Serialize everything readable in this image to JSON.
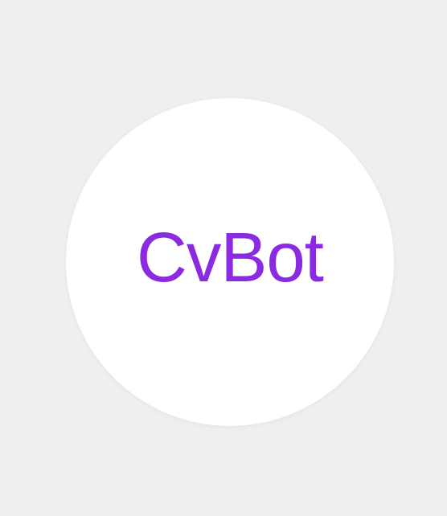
{
  "logo": {
    "text": "CvBot",
    "text_color": "#8a2be2",
    "circle_color": "#ffffff"
  },
  "page": {
    "background_color": "#efefef"
  }
}
